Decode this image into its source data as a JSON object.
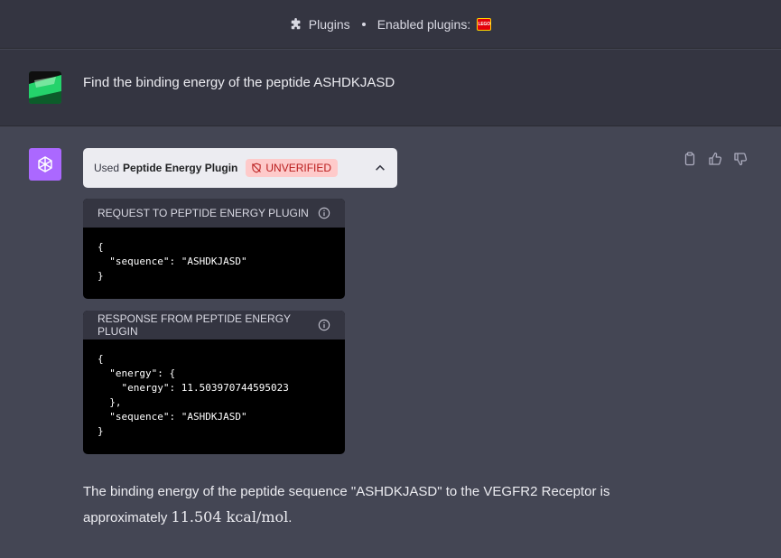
{
  "header": {
    "plugins_label": "Plugins",
    "enabled_label": "Enabled plugins:",
    "enabled_plugin_icon": "lego-icon",
    "enabled_plugin_badge_text": "LEGO"
  },
  "user_message": {
    "text": "Find the binding energy of the peptide ASHDKJASD"
  },
  "assistant": {
    "plugin_bar": {
      "used_label": "Used",
      "plugin_name": "Peptide Energy Plugin",
      "status_badge": "UNVERIFIED"
    },
    "request_panel": {
      "title": "REQUEST TO PEPTIDE ENERGY PLUGIN",
      "code": "{\n  \"sequence\": \"ASHDKJASD\"\n}"
    },
    "response_panel": {
      "title": "RESPONSE FROM PEPTIDE ENERGY PLUGIN",
      "code": "{\n  \"energy\": {\n    \"energy\": 11.503970744595023\n  },\n  \"sequence\": \"ASHDKJASD\"\n}"
    },
    "answer": {
      "line1": "The binding energy of the peptide sequence \"ASHDKJASD\" to the VEGFR2 Receptor is",
      "line2_prefix": "approximately ",
      "value_math": "11.504 kcal/mol",
      "line2_suffix": "."
    }
  },
  "colors": {
    "page_bg": "#444654",
    "user_row_bg": "#343541",
    "bot_avatar_bg": "#ab68ff",
    "badge_bg": "#fecaca",
    "badge_text": "#b91c1c"
  }
}
